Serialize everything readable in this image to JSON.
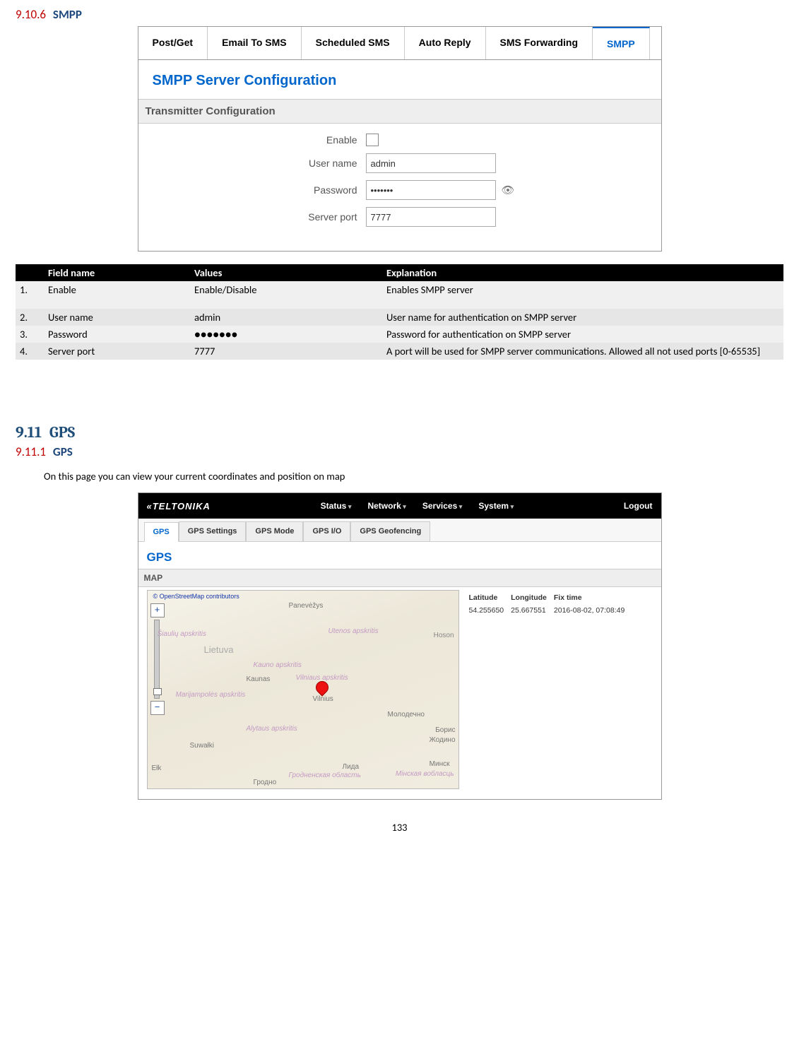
{
  "section1": {
    "num": "9.10.6",
    "title": "SMPP"
  },
  "shot1": {
    "tabs": [
      "Post/Get",
      "Email To SMS",
      "Scheduled SMS",
      "Auto Reply",
      "SMS Forwarding",
      "SMPP"
    ],
    "active_tab": "SMPP",
    "title": "SMPP Server Configuration",
    "subhead": "Transmitter Configuration",
    "fields": {
      "enable_label": "Enable",
      "username_label": "User name",
      "username_value": "admin",
      "password_label": "Password",
      "password_value": "•••••••",
      "serverport_label": "Server port",
      "serverport_value": "7777"
    }
  },
  "fields_table": {
    "headers": {
      "num": "",
      "field": "Field name",
      "values": "Values",
      "expl": "Explanation"
    },
    "rows": [
      {
        "n": "1.",
        "field": "Enable",
        "values": "Enable/Disable",
        "expl": "Enables SMPP server",
        "tall": true
      },
      {
        "n": "2.",
        "field": "User name",
        "values": "admin",
        "expl": "User name for authentication on SMPP server"
      },
      {
        "n": "3.",
        "field": "Password",
        "values": "●●●●●●●",
        "expl": "Password for authentication on SMPP server"
      },
      {
        "n": "4.",
        "field": "Server port",
        "values": "7777",
        "expl": "A port will be used for SMPP server communications. Allowed all not used ports [0-65535]"
      }
    ]
  },
  "section2": {
    "num": "9.11",
    "title": "GPS"
  },
  "section3": {
    "num": "9.11.1",
    "title": "GPS"
  },
  "gps_intro": "On this page you can view your current coordinates and position on map",
  "shot2": {
    "brand": "«TELTONIKA",
    "menu": [
      "Status",
      "Network",
      "Services",
      "System"
    ],
    "logout": "Logout",
    "tabs": [
      "GPS",
      "GPS Settings",
      "GPS Mode",
      "GPS I/O",
      "GPS Geofencing"
    ],
    "active_tab": "GPS",
    "title": "GPS",
    "map_head": "MAP",
    "contrib": "© OpenStreetMap contributors",
    "coords": {
      "headers": {
        "lat": "Latitude",
        "lon": "Longitude",
        "fix": "Fix time"
      },
      "row": {
        "lat": "54.255650",
        "lon": "25.667551",
        "fix": "2016-08-02, 07:08:49"
      }
    },
    "map_labels": {
      "hoson": "Hoson",
      "panevezys": "Panevėžys",
      "utenos": "Utenos apskritis",
      "lietuva": "Lietuva",
      "kauno": "Kauno apskritis",
      "kaunas": "Kaunas",
      "marij": "Marijampolės apskritis",
      "vilniaus": "Vilniaus apskritis",
      "vilnius": "Vilnius",
      "alytaus": "Alytaus apskritis",
      "molod": "Молодечно",
      "borisov": "Борис",
      "zhodino": "Жодино",
      "suwalki": "Suwałki",
      "ek": "Ełk",
      "lida": "Лида",
      "minsk": "Минск",
      "minsk_obl": "Мінская вобласць",
      "grodno_obl": "Гродненская область",
      "grodno": "Гродно",
      "siauliai": "Šiaulių apskritis"
    }
  },
  "page_number": "133"
}
